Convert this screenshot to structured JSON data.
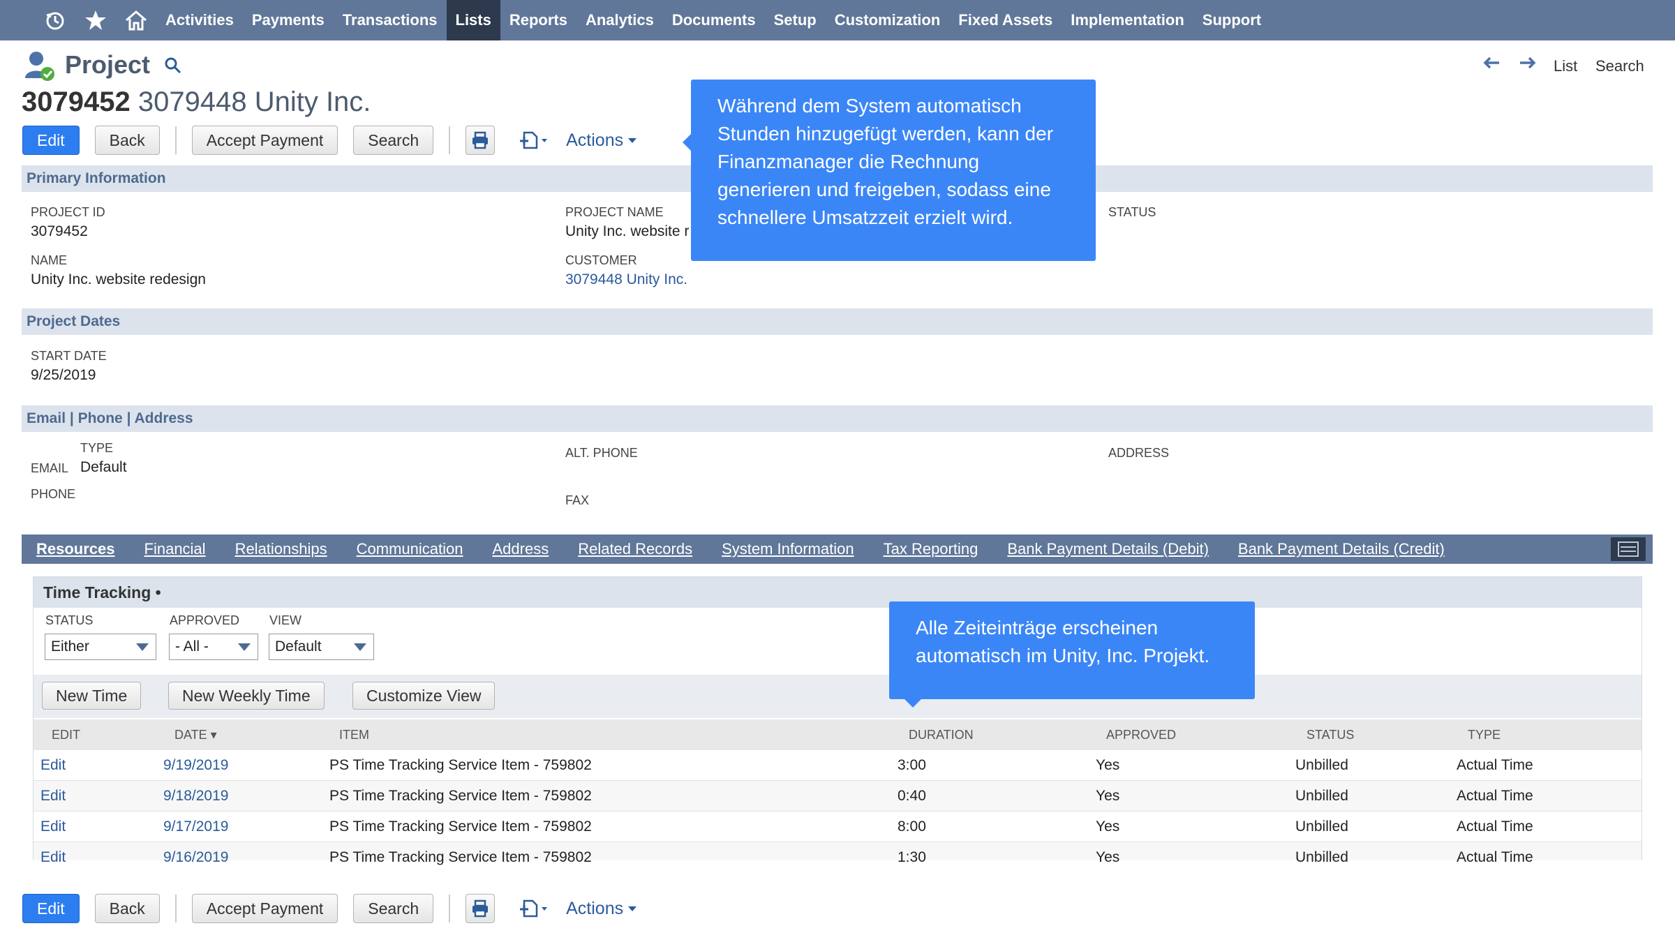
{
  "nav": {
    "icons": [
      "recent-records-icon",
      "star-icon",
      "home-icon"
    ],
    "items": [
      "Activities",
      "Payments",
      "Transactions",
      "Lists",
      "Reports",
      "Analytics",
      "Documents",
      "Setup",
      "Customization",
      "Fixed Assets",
      "Implementation",
      "Support"
    ],
    "active": "Lists"
  },
  "record": {
    "type": "Project",
    "id": "3079452",
    "title_rest": "3079448 Unity Inc."
  },
  "record_nav": {
    "list": "List",
    "search": "Search"
  },
  "buttons": {
    "edit": "Edit",
    "back": "Back",
    "accept_payment": "Accept Payment",
    "search": "Search",
    "actions": "Actions"
  },
  "primary_info": {
    "heading": "Primary Information",
    "project_id_label": "PROJECT ID",
    "project_id": "3079452",
    "project_name_label": "PROJECT NAME",
    "project_name": "Unity Inc. website r",
    "status_label": "STATUS",
    "name_label": "NAME",
    "name": "Unity Inc. website redesign",
    "customer_label": "CUSTOMER",
    "customer": "3079448 Unity Inc."
  },
  "project_dates": {
    "heading": "Project Dates",
    "start_date_label": "START DATE",
    "start_date": "9/25/2019"
  },
  "contact": {
    "heading": "Email | Phone | Address",
    "type_label": "TYPE",
    "email_label": "EMAIL",
    "email_type": "Default",
    "alt_phone_label": "ALT. PHONE",
    "address_label": "ADDRESS",
    "phone_label": "PHONE",
    "fax_label": "FAX"
  },
  "tabs": [
    "Resources",
    "Financial",
    "Relationships",
    "Communication",
    "Address",
    "Related Records",
    "System Information",
    "Tax Reporting",
    "Bank Payment Details (Debit)",
    "Bank Payment Details (Credit)"
  ],
  "time_tracking": {
    "subtab": "Time Tracking •",
    "status_label": "STATUS",
    "status_value": "Either",
    "approved_label": "APPROVED",
    "approved_value": "- All -",
    "view_label": "VIEW",
    "view_value": "Default",
    "new_time": "New Time",
    "new_weekly_time": "New Weekly Time",
    "customize_view": "Customize View",
    "columns": [
      "EDIT",
      "DATE ▾",
      "ITEM",
      "DURATION",
      "APPROVED",
      "STATUS",
      "TYPE"
    ],
    "rows": [
      {
        "edit": "Edit",
        "date": "9/19/2019",
        "item": "PS Time Tracking Service Item - 759802",
        "duration": "3:00",
        "approved": "Yes",
        "status": "Unbilled",
        "type": "Actual Time"
      },
      {
        "edit": "Edit",
        "date": "9/18/2019",
        "item": "PS Time Tracking Service Item - 759802",
        "duration": "0:40",
        "approved": "Yes",
        "status": "Unbilled",
        "type": "Actual Time"
      },
      {
        "edit": "Edit",
        "date": "9/17/2019",
        "item": "PS Time Tracking Service Item - 759802",
        "duration": "8:00",
        "approved": "Yes",
        "status": "Unbilled",
        "type": "Actual Time"
      },
      {
        "edit": "Edit",
        "date": "9/16/2019",
        "item": "PS Time Tracking Service Item - 759802",
        "duration": "1:30",
        "approved": "Yes",
        "status": "Unbilled",
        "type": "Actual Time"
      }
    ]
  },
  "tooltips": {
    "one": "Während dem System automatisch Stunden hinzugefügt werden, kann der Finanzmanager die Rechnung generieren und freigeben, sodass eine schnellere Umsatzzeit erzielt wird.",
    "two": "Alle Zeiteinträge erscheinen automatisch im Unity, Inc. Projekt."
  },
  "colors": {
    "nav": "#607799",
    "nav_active": "#2d3a4d",
    "primary_button": "#2c7df0",
    "section_bg": "#dde3ec",
    "tooltip": "#3b86f7",
    "link": "#2b5a9b"
  }
}
